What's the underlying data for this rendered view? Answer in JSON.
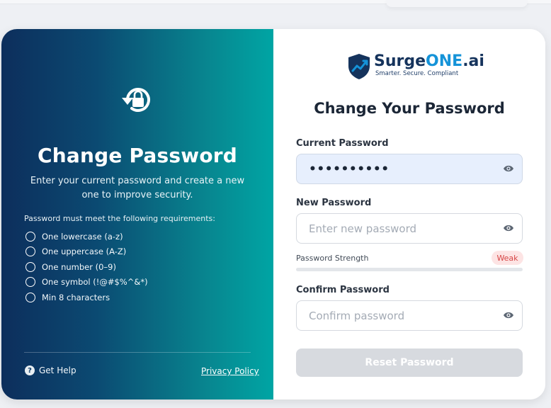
{
  "left_panel": {
    "title": "Change Password",
    "subtitle": "Enter your current password and create a new one to improve security.",
    "requirements_title": "Password must meet the following requirements:",
    "requirements": [
      "One lowercase (a-z)",
      "One uppercase (A-Z)",
      "One number (0–9)",
      "One symbol (!@#$%^&*)",
      "Min 8 characters"
    ],
    "help_label": "Get Help",
    "privacy_label": "Privacy Policy",
    "hero_icon": "lock-reset-icon"
  },
  "brand": {
    "name_part1": "Surge",
    "name_part2": "ONE",
    "name_part3": ".ai",
    "tagline": "Smarter. Secure. Compliant",
    "colors": {
      "navy": "#15335c",
      "blue": "#1593d8"
    }
  },
  "form": {
    "title": "Change Your Password",
    "current_label": "Current Password",
    "current_value": "••••••••••",
    "new_label": "New Password",
    "new_placeholder": "Enter new password",
    "strength_label": "Password Strength",
    "strength_value": "Weak",
    "strength_level": 0,
    "confirm_label": "Confirm Password",
    "confirm_placeholder": "Confirm password",
    "submit_label": "Reset Password"
  },
  "colors": {
    "panel_gradient_start": "#0d2e5c",
    "panel_gradient_end": "#00a5a4",
    "weak_badge_bg": "#fde4e4",
    "weak_badge_text": "#d64545",
    "button_disabled": "#d7dadf"
  }
}
